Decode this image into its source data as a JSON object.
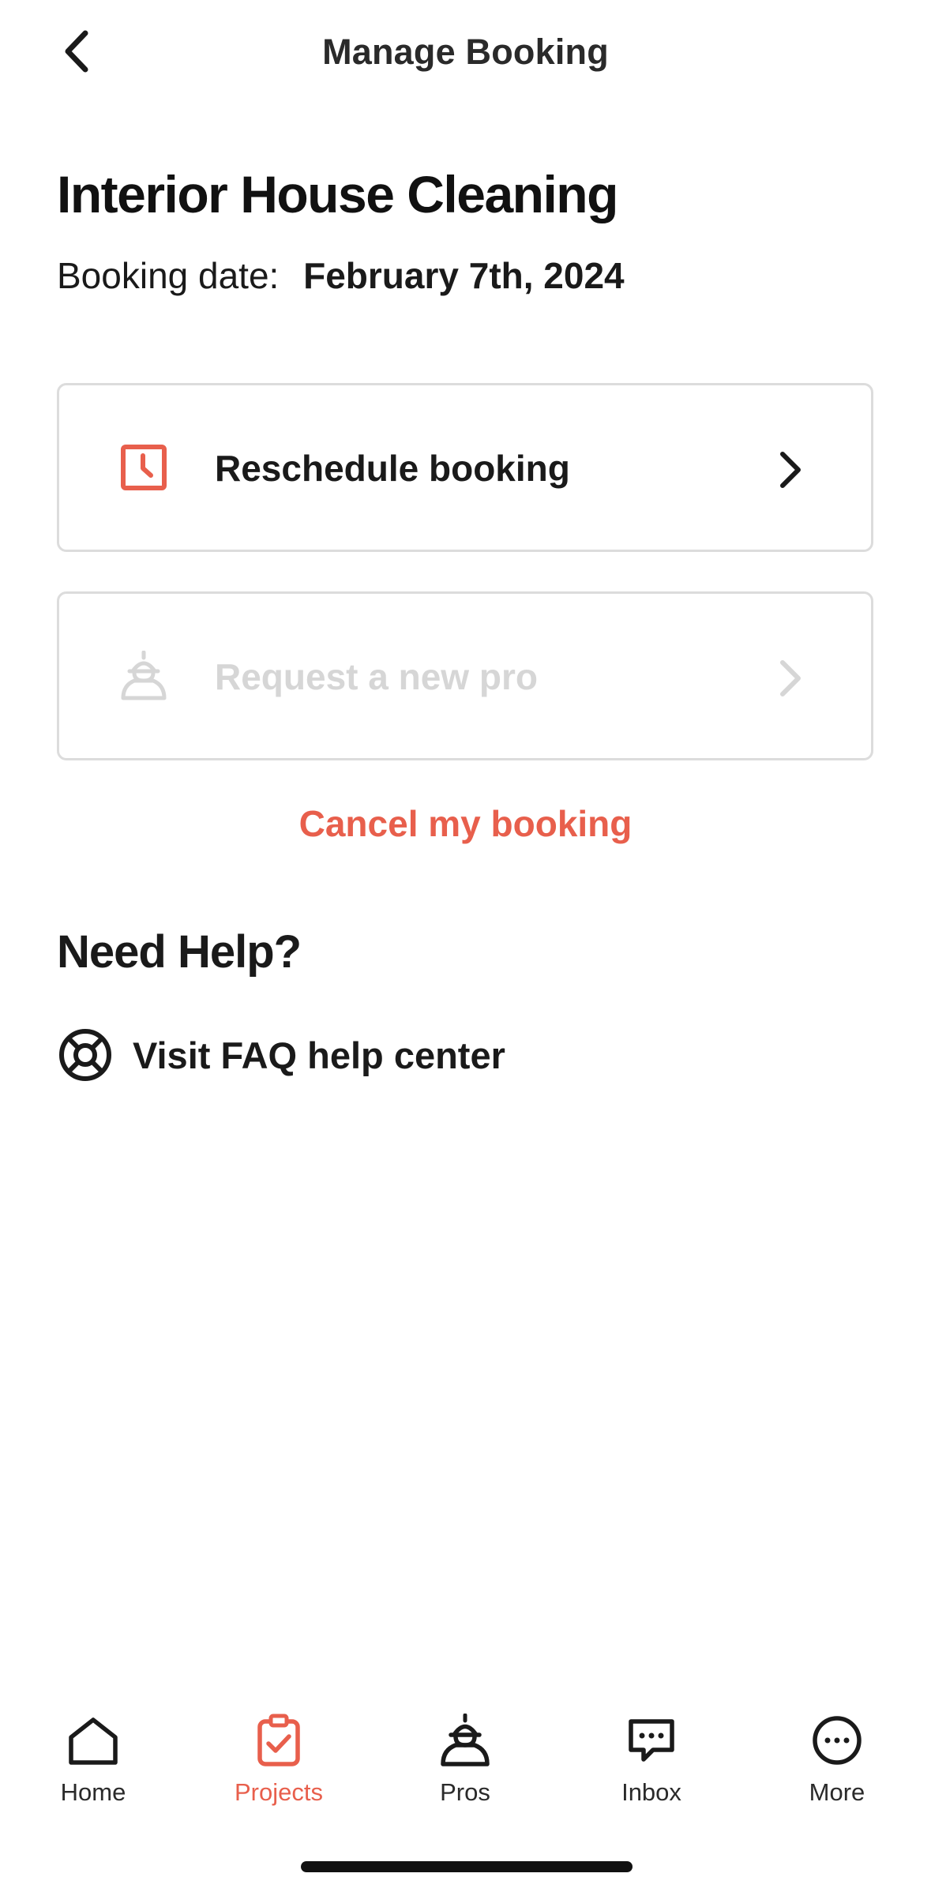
{
  "header": {
    "title": "Manage Booking",
    "back_icon": "chevron-left-icon"
  },
  "booking": {
    "title": "Interior House Cleaning",
    "date_label": "Booking date:",
    "date_value": "February 7th, 2024"
  },
  "actions": [
    {
      "label": "Reschedule booking",
      "icon": "clock-icon",
      "enabled": true
    },
    {
      "label": "Request a new pro",
      "icon": "pro-icon",
      "enabled": false
    }
  ],
  "cancel": {
    "label": "Cancel my booking"
  },
  "help": {
    "title": "Need Help?",
    "faq_label": "Visit FAQ help center",
    "faq_icon": "lifebuoy-icon"
  },
  "tabbar": {
    "items": [
      {
        "label": "Home",
        "icon": "home-icon"
      },
      {
        "label": "Projects",
        "icon": "clipboard-check-icon",
        "active": true
      },
      {
        "label": "Pros",
        "icon": "pro-icon"
      },
      {
        "label": "Inbox",
        "icon": "chat-icon"
      },
      {
        "label": "More",
        "icon": "more-icon"
      }
    ]
  },
  "colors": {
    "accent": "#e85f4c",
    "text": "#1a1a1a",
    "disabled": "#d6d6d6",
    "border": "#dcdcdc"
  }
}
